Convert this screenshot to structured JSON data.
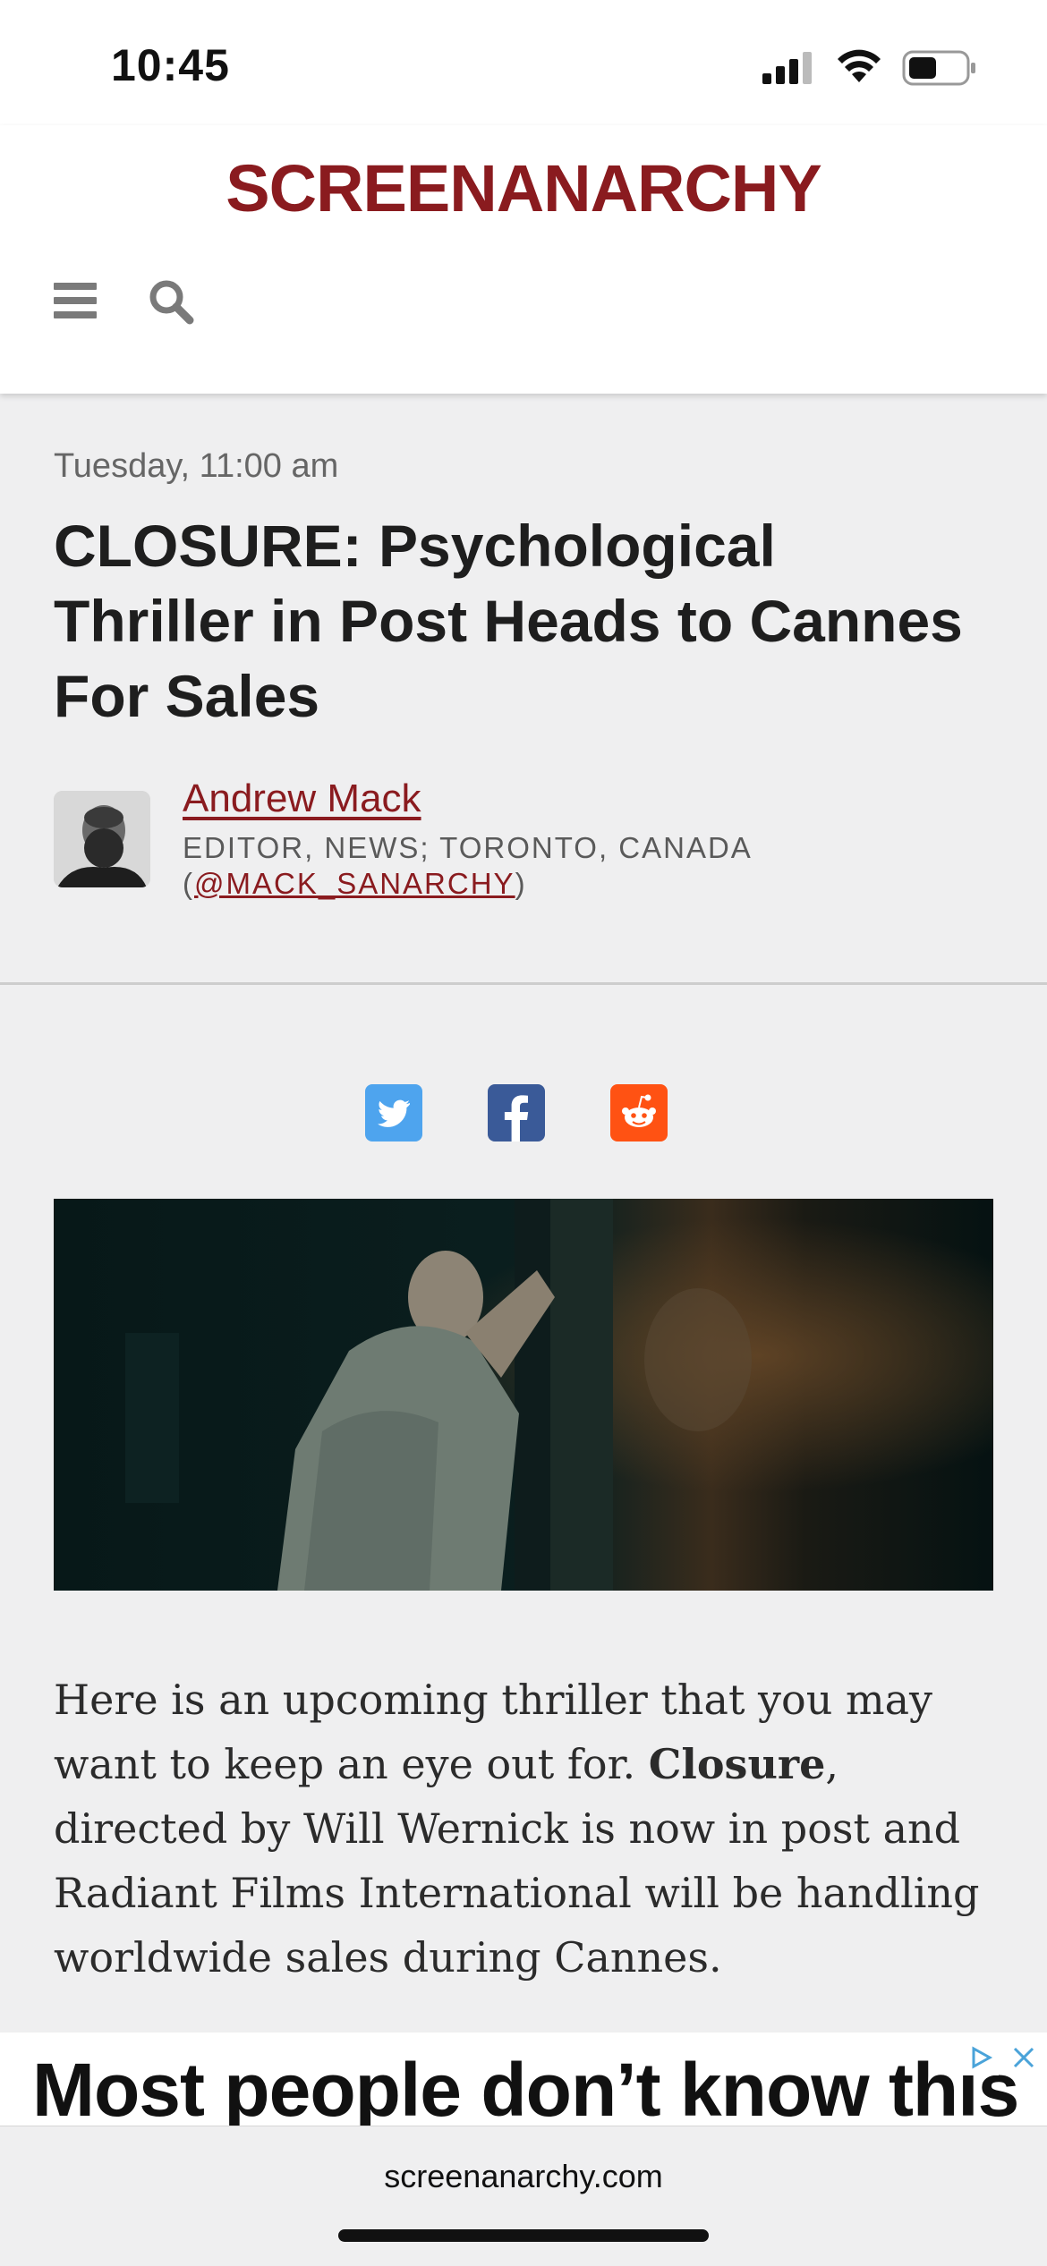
{
  "status_bar": {
    "time": "10:45"
  },
  "header": {
    "logo_text": "SCREENANARCHY"
  },
  "article": {
    "date": "Tuesday, 11:00 am",
    "title": "CLOSURE: Psychological Thriller in Post Heads to Cannes For Sales",
    "author": {
      "name": "Andrew Mack",
      "role": "EDITOR, NEWS; TORONTO, CANADA",
      "handle": "@MACK_SANARCHY"
    },
    "share": [
      "twitter-share",
      "facebook-share",
      "reddit-share"
    ],
    "body": {
      "part1": "Here is an upcoming thriller that you may want to keep an eye out for. ",
      "bold": "Closure",
      "part2": ", directed by Will Wernick is now in post and Radiant Films International will be handling worldwide sales during Cannes."
    }
  },
  "ad": {
    "text": "Most people don’t know this"
  },
  "browser": {
    "url": "screenanarchy.com"
  },
  "colors": {
    "brand": "#8a1b1f",
    "twitter": "#4ea4ee",
    "facebook": "#3a5a98",
    "reddit": "#ff5213"
  }
}
